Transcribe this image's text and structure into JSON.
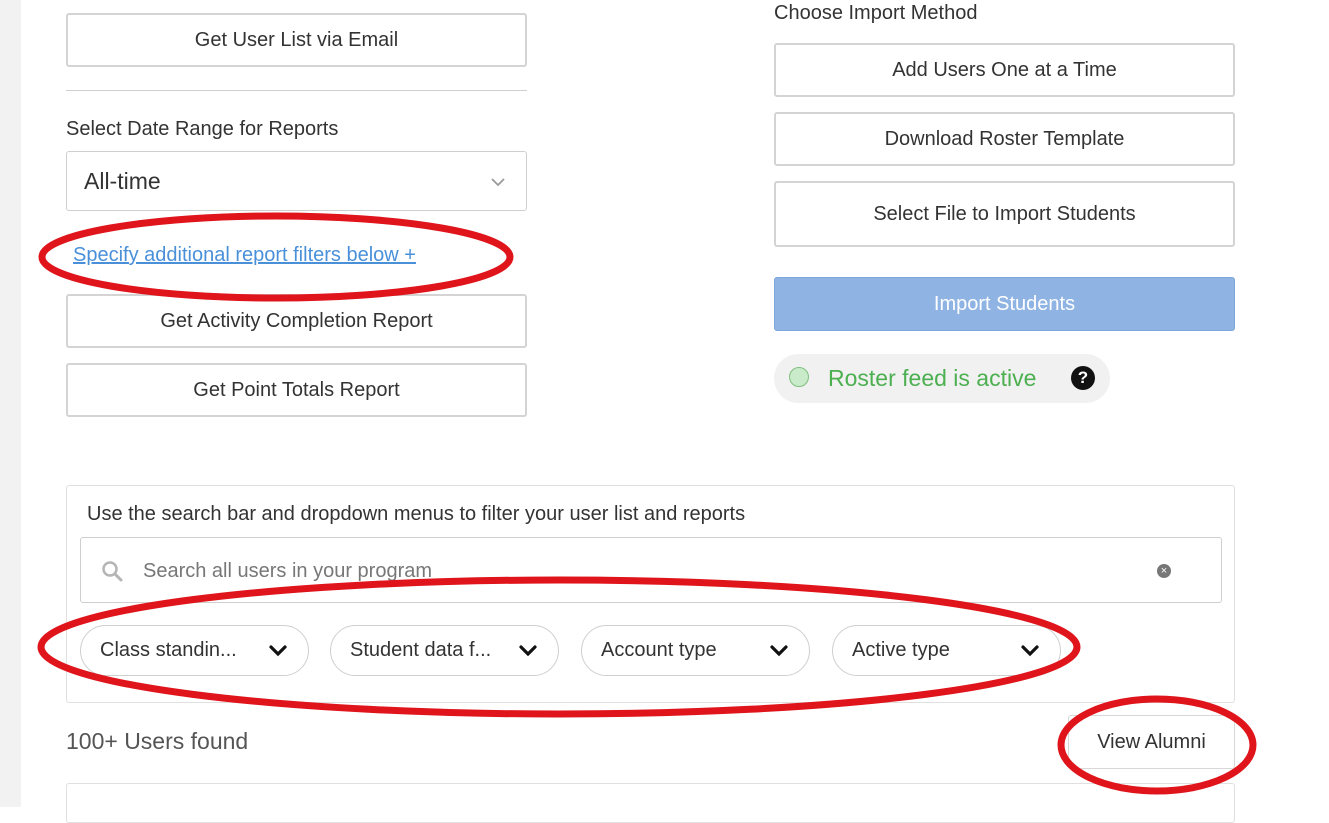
{
  "left": {
    "email_button": "Get User List via Email",
    "date_range_label": "Select Date Range for Reports",
    "date_range_value": "All-time",
    "additional_filters_link": "Specify additional report filters below +",
    "activity_report_button": "Get Activity Completion Report",
    "point_totals_button": "Get Point Totals Report"
  },
  "right": {
    "import_method_label": "Choose Import Method",
    "add_users_button": "Add Users One at a Time",
    "download_template_button": "Download Roster Template",
    "select_file_button": "Select File to Import Students",
    "import_students_button": "Import Students",
    "roster_status": "Roster feed is active",
    "help_glyph": "?"
  },
  "filters": {
    "hint": "Use the search bar and dropdown menus to filter your user list and reports",
    "search_placeholder": "Search all users in your program",
    "dropdowns": [
      "Class standin...",
      "Student data f...",
      "Account type",
      "Active type"
    ]
  },
  "results": {
    "count_text": "100+ Users found",
    "view_alumni_button": "View Alumni"
  },
  "colors": {
    "link": "#4a90d9",
    "import_button": "#8fb4e3",
    "roster_green": "#4caf50",
    "annotation_red": "#e0141b"
  },
  "icons": [
    "search-icon",
    "clear-icon",
    "chevron-down-icon",
    "help-icon",
    "status-dot-icon"
  ]
}
